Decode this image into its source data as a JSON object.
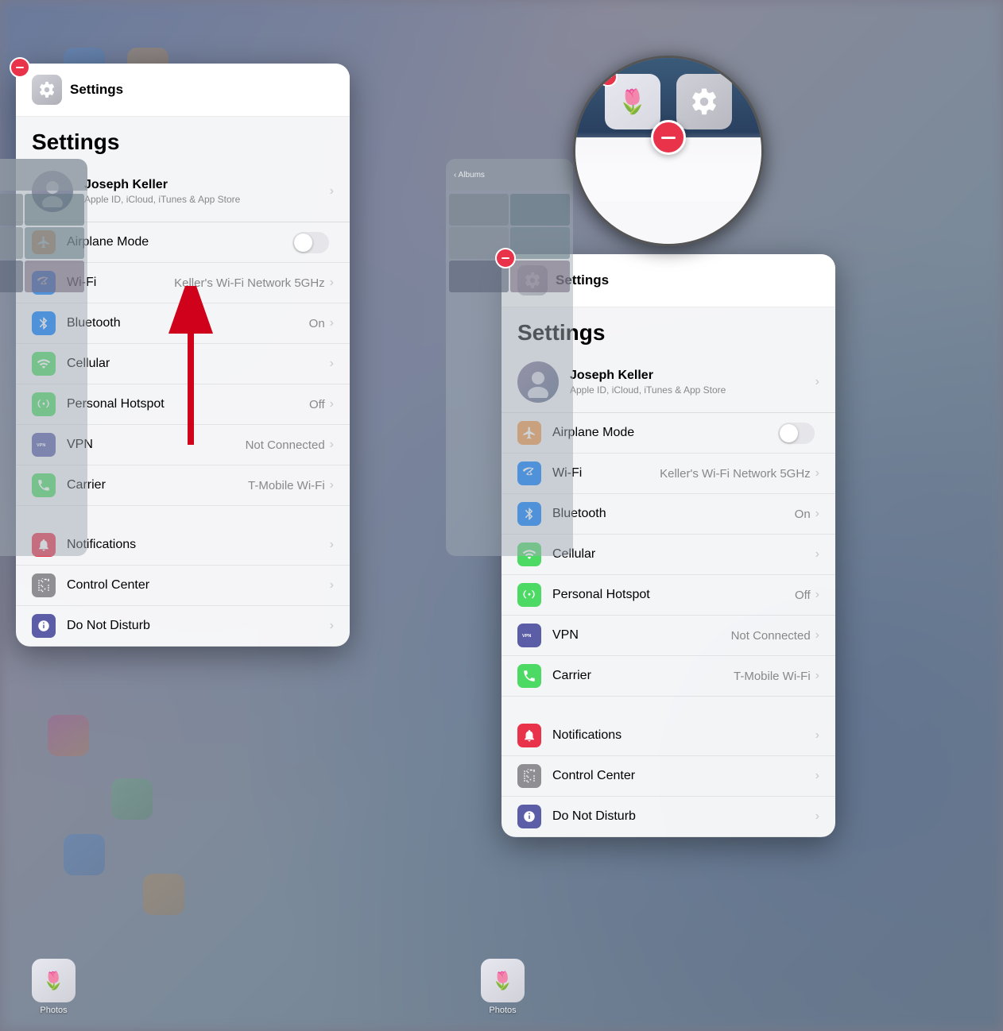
{
  "background": {
    "color": "#7a8090"
  },
  "left_panel": {
    "header": {
      "title": "Settings",
      "icon_label": "settings-gear-icon"
    },
    "user": {
      "name": "Joseph Keller",
      "subtitle": "Apple ID, iCloud, iTunes & App Store",
      "avatar_emoji": "👤"
    },
    "settings_title": "Settings",
    "items_group1": [
      {
        "id": "airplane",
        "label": "Airplane Mode",
        "icon_color": "#f2994a",
        "icon": "✈",
        "type": "toggle",
        "toggle_on": false,
        "value": ""
      },
      {
        "id": "wifi",
        "label": "Wi-Fi",
        "icon_color": "#007aff",
        "icon": "📶",
        "type": "chevron",
        "value": "Keller's Wi-Fi Network 5GHz"
      },
      {
        "id": "bluetooth",
        "label": "Bluetooth",
        "icon_color": "#007aff",
        "icon": "⬡",
        "type": "chevron",
        "value": "On"
      },
      {
        "id": "cellular",
        "label": "Cellular",
        "icon_color": "#4cd964",
        "icon": "◉",
        "type": "chevron",
        "value": ""
      },
      {
        "id": "hotspot",
        "label": "Personal Hotspot",
        "icon_color": "#4cd964",
        "icon": "⦾",
        "type": "chevron",
        "value": "Off"
      },
      {
        "id": "vpn",
        "label": "VPN",
        "icon_color": "#5b5ea6",
        "icon": "VPN",
        "type": "chevron",
        "value": "Not Connected"
      },
      {
        "id": "carrier",
        "label": "Carrier",
        "icon_color": "#4cd964",
        "icon": "📞",
        "type": "chevron",
        "value": "T-Mobile Wi-Fi"
      }
    ],
    "items_group2": [
      {
        "id": "notifications",
        "label": "Notifications",
        "icon_color": "#e8334a",
        "icon": "🔔",
        "type": "chevron",
        "value": ""
      },
      {
        "id": "controlcenter",
        "label": "Control Center",
        "icon_color": "#8e8e93",
        "icon": "⊞",
        "type": "chevron",
        "value": ""
      },
      {
        "id": "donotdisturb",
        "label": "Do Not Disturb",
        "icon_color": "#5b5ea6",
        "icon": "🌙",
        "type": "chevron",
        "value": ""
      }
    ],
    "arrow": {
      "visible": true
    }
  },
  "right_panel": {
    "header": {
      "title": "Settings",
      "icon_label": "settings-gear-icon"
    },
    "user": {
      "name": "Joseph Keller",
      "subtitle": "Apple ID, iCloud, iTunes & App Store",
      "avatar_emoji": "👤"
    },
    "settings_title": "Settings",
    "items_group1": [
      {
        "id": "airplane",
        "label": "Airplane Mode",
        "icon_color": "#f2994a",
        "icon": "✈",
        "type": "toggle",
        "toggle_on": false,
        "value": ""
      },
      {
        "id": "wifi",
        "label": "Wi-Fi",
        "icon_color": "#007aff",
        "icon": "📶",
        "type": "chevron",
        "value": "Keller's Wi-Fi Network 5GHz"
      },
      {
        "id": "bluetooth",
        "label": "Bluetooth",
        "icon_color": "#007aff",
        "icon": "⬡",
        "type": "chevron",
        "value": "On"
      },
      {
        "id": "cellular",
        "label": "Cellular",
        "icon_color": "#4cd964",
        "icon": "◉",
        "type": "chevron",
        "value": ""
      },
      {
        "id": "hotspot",
        "label": "Personal Hotspot",
        "icon_color": "#4cd964",
        "icon": "⦾",
        "type": "chevron",
        "value": "Off"
      },
      {
        "id": "vpn",
        "label": "VPN",
        "icon_color": "#5b5ea6",
        "icon": "VPN",
        "type": "chevron",
        "value": "Not Connected"
      },
      {
        "id": "carrier",
        "label": "Carrier",
        "icon_color": "#4cd964",
        "icon": "📞",
        "type": "chevron",
        "value": "T-Mobile Wi-Fi"
      }
    ],
    "items_group2": [
      {
        "id": "notifications",
        "label": "Notifications",
        "icon_color": "#e8334a",
        "icon": "🔔",
        "type": "chevron",
        "value": ""
      },
      {
        "id": "controlcenter",
        "label": "Control Center",
        "icon_color": "#8e8e93",
        "icon": "⊞",
        "type": "chevron",
        "value": ""
      },
      {
        "id": "donotdisturb",
        "label": "Do Not Disturb",
        "icon_color": "#5b5ea6",
        "icon": "🌙",
        "type": "chevron",
        "value": ""
      }
    ],
    "zoom": {
      "visible": true
    }
  },
  "icons": {
    "chevron": "›",
    "airplane": "✈",
    "wifi": "wifi",
    "bluetooth": "bluetooth",
    "cellular": "cellular",
    "hotspot": "hotspot",
    "vpn": "VPN",
    "carrier": "carrier",
    "notifications": "bell",
    "controlcenter": "grid",
    "donotdisturb": "moon"
  }
}
